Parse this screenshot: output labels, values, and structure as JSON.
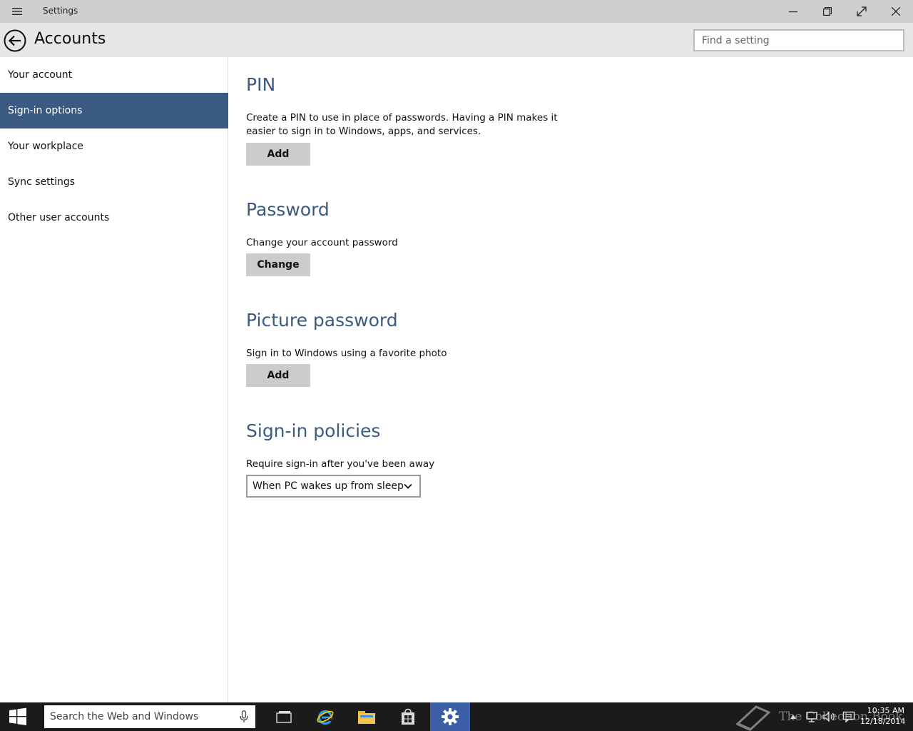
{
  "window": {
    "title": "Settings"
  },
  "header": {
    "title": "Accounts",
    "search_placeholder": "Find a setting"
  },
  "sidebar": {
    "items": [
      {
        "label": "Your account",
        "selected": false
      },
      {
        "label": "Sign-in options",
        "selected": true
      },
      {
        "label": "Your workplace",
        "selected": false
      },
      {
        "label": "Sync settings",
        "selected": false
      },
      {
        "label": "Other user accounts",
        "selected": false
      }
    ]
  },
  "sections": {
    "pin": {
      "heading": "PIN",
      "description": "Create a PIN to use in place of passwords. Having a PIN makes it easier to sign in to Windows, apps, and services.",
      "button": "Add"
    },
    "password": {
      "heading": "Password",
      "description": "Change your account password",
      "button": "Change"
    },
    "picture_password": {
      "heading": "Picture password",
      "description": "Sign in to Windows using a favorite photo",
      "button": "Add"
    },
    "signin_policies": {
      "heading": "Sign-in policies",
      "description": "Require sign-in after you've been away",
      "dropdown_value": "When PC wakes up from sleep"
    }
  },
  "taskbar": {
    "search_placeholder": "Search the Web and Windows",
    "clock_time": "10:35 AM",
    "clock_date": "12/18/2014",
    "watermark": "The Collection Book"
  },
  "colors": {
    "accent": "#3a5a82",
    "titlebar": "#cfcfcf",
    "header": "#e6e6e6",
    "taskbar": "#1b1b1b",
    "taskbar_active": "#3c5ea6"
  },
  "icons": {
    "menu": "hamburger-icon",
    "back": "back-arrow-icon",
    "minimize": "minimize-icon",
    "restore": "restore-icon",
    "fullscreen": "fullscreen-icon",
    "close": "close-icon",
    "dropdown": "chevron-down-icon",
    "start": "windows-logo-icon",
    "mic": "microphone-icon",
    "task_view": "task-view-icon",
    "browser": "internet-explorer-icon",
    "explorer": "file-explorer-icon",
    "store": "store-icon",
    "settings": "gear-icon"
  }
}
